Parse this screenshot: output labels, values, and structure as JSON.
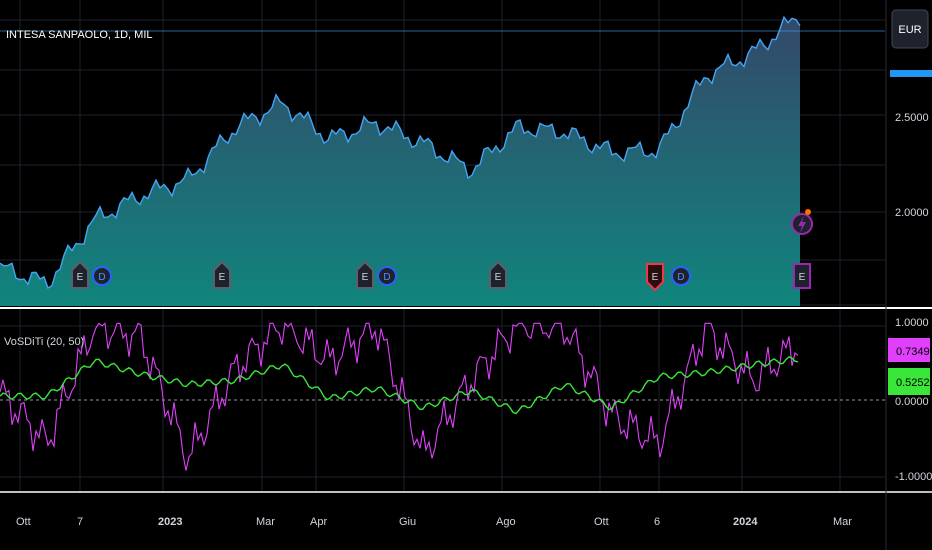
{
  "header": {
    "symbol_title": "INTESA SANPAOLO, 1D, MIL",
    "currency_button": "EUR"
  },
  "colors": {
    "background": "#000000",
    "grid": "#1e222d",
    "price_line": "#42a5f5",
    "area_top": "#34486a",
    "area_bottom": "#10857d",
    "indicator_magenta": "#e040fb",
    "indicator_green": "#39e639",
    "divider": "#ffffff"
  },
  "price_axis": {
    "ticks": [
      "2.5000",
      "2.0000"
    ]
  },
  "indicator": {
    "title": "VoSDiTi (20, 50)",
    "axis_ticks": [
      "1.0000",
      "0.0000",
      "-1.0000"
    ],
    "value_magenta": "0.7349",
    "value_green": "0.5252"
  },
  "time_axis": {
    "labels": [
      "Ott",
      "7",
      "2023",
      "Mar",
      "Apr",
      "Giu",
      "Ago",
      "Ott",
      "6",
      "2024",
      "Mar"
    ]
  },
  "event_markers": [
    {
      "letter": "E",
      "kind": "earnings",
      "color": "#2a2e39"
    },
    {
      "letter": "D",
      "kind": "dividend",
      "color": "#2962ff"
    },
    {
      "letter": "E",
      "kind": "earnings",
      "color": "#2a2e39"
    },
    {
      "letter": "E",
      "kind": "earnings",
      "color": "#2a2e39"
    },
    {
      "letter": "D",
      "kind": "dividend",
      "color": "#2962ff"
    },
    {
      "letter": "E",
      "kind": "earnings",
      "color": "#2a2e39"
    },
    {
      "letter": "E",
      "kind": "earnings-negative",
      "color": "#f23645"
    },
    {
      "letter": "D",
      "kind": "dividend",
      "color": "#2962ff"
    },
    {
      "letter": "E",
      "kind": "earnings-upcoming",
      "color": "#9c27b0"
    }
  ],
  "chart_data": [
    {
      "type": "area",
      "y_scale": "price (EUR)",
      "ylim": [
        1.66,
        2.97
      ],
      "x": [
        "2022-09",
        "2022-10",
        "2022-11",
        "2022-12",
        "2023-01",
        "2023-02",
        "2023-03",
        "2023-04",
        "2023-05",
        "2023-06",
        "2023-07",
        "2023-08",
        "2023-09",
        "2023-10",
        "2023-11",
        "2023-12",
        "2024-01",
        "2024-02"
      ],
      "y": [
        1.83,
        1.76,
        2.04,
        2.15,
        2.22,
        2.45,
        2.56,
        2.4,
        2.47,
        2.38,
        2.26,
        2.45,
        2.43,
        2.34,
        2.35,
        2.68,
        2.78,
        2.95
      ],
      "grid": true
    },
    {
      "type": "line",
      "ylim": [
        -1.15,
        1.15
      ],
      "x": [
        "2022-09",
        "2022-10",
        "2022-11",
        "2022-12",
        "2023-01",
        "2023-02",
        "2023-03",
        "2023-04",
        "2023-05",
        "2023-06",
        "2023-07",
        "2023-08",
        "2023-09",
        "2023-10",
        "2023-11",
        "2023-12",
        "2024-01",
        "2024-02"
      ],
      "series": [
        {
          "values": [
            0.1,
            -0.55,
            0.95,
            0.8,
            -0.75,
            0.4,
            0.98,
            0.5,
            0.95,
            -0.7,
            0.25,
            0.98,
            0.95,
            -0.2,
            -0.55,
            0.92,
            0.25,
            0.74
          ]
        },
        {
          "values": [
            0.05,
            0.05,
            0.5,
            0.33,
            0.2,
            0.25,
            0.45,
            0.02,
            0.15,
            -0.1,
            0.12,
            -0.15,
            0.2,
            -0.1,
            0.3,
            0.35,
            0.45,
            0.53
          ]
        }
      ],
      "zero_line": "dashed",
      "grid": true
    }
  ]
}
